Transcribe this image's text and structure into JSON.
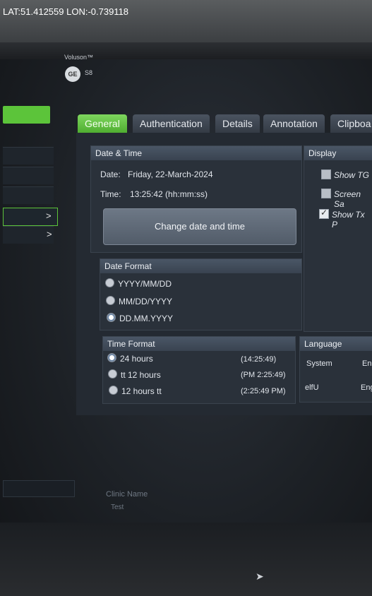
{
  "overlay": {
    "gps_text": "LAT:51.412559 LON:-0.739118"
  },
  "device": {
    "brand": "Voluson™",
    "model": "S8",
    "logo_text": "GE"
  },
  "sidebar": {
    "arrow_1": ">",
    "arrow_2": ">"
  },
  "tabs": [
    {
      "label": "General",
      "active": true
    },
    {
      "label": "Authentication"
    },
    {
      "label": "Details"
    },
    {
      "label": "Annotation"
    },
    {
      "label": "Clipboa"
    }
  ],
  "date_time": {
    "title": "Date & Time",
    "date_label": "Date:",
    "date_value": "Friday, 22-March-2024",
    "time_label": "Time:",
    "time_value": "13:25:42 (hh:mm:ss)",
    "change_button": "Change date and time"
  },
  "display": {
    "title": "Display",
    "options": [
      {
        "label": "Show TG",
        "checked": false
      },
      {
        "label": "Screen Sa",
        "checked": false
      },
      {
        "label": "Show Tx P",
        "checked": true
      }
    ]
  },
  "date_format": {
    "title": "Date Format",
    "options": [
      {
        "label": "YYYY/MM/DD",
        "selected": false
      },
      {
        "label": "MM/DD/YYYY",
        "selected": false
      },
      {
        "label": "DD.MM.YYYY",
        "selected": true
      }
    ]
  },
  "time_format": {
    "title": "Time Format",
    "options": [
      {
        "label": "24 hours",
        "example": "(14:25:49)",
        "selected": true
      },
      {
        "label": "tt 12 hours",
        "example": "(PM 2:25:49)",
        "selected": false
      },
      {
        "label": "12 hours tt",
        "example": "(2:25:49 PM)",
        "selected": false
      }
    ]
  },
  "language": {
    "title": "Language",
    "rows": [
      {
        "label": "System",
        "value": "En"
      },
      {
        "label": "elfU",
        "value": "Eng"
      }
    ]
  },
  "clinic": {
    "label": "Clinic Name",
    "value": "Test"
  },
  "colors": {
    "accent_green": "#5cc43a",
    "panel_bg": "#242a32",
    "section_head": "#4a5666"
  }
}
